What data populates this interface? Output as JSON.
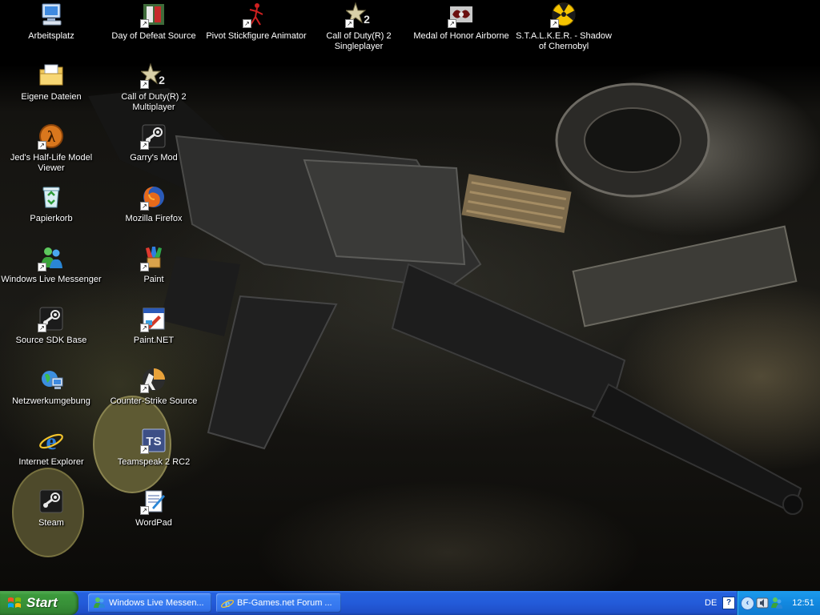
{
  "desktop": {
    "icons": [
      {
        "label": "Arbeitsplatz",
        "icon": "my-computer-icon",
        "shortcut": false
      },
      {
        "label": "Day of Defeat Source",
        "icon": "dod-source-icon",
        "shortcut": true
      },
      {
        "label": "Pivot Stickfigure Animator",
        "icon": "pivot-icon",
        "shortcut": true
      },
      {
        "label": "Call of Duty(R) 2 Singleplayer",
        "icon": "cod2-icon",
        "shortcut": true
      },
      {
        "label": "Medal of Honor Airborne",
        "icon": "moh-icon",
        "shortcut": true
      },
      {
        "label": "S.T.A.L.K.E.R. - Shadow of Chernobyl",
        "icon": "radiation-icon",
        "shortcut": true
      },
      {
        "label": "Eigene Dateien",
        "icon": "my-documents-icon",
        "shortcut": false
      },
      {
        "label": "Call of Duty(R) 2 Multiplayer",
        "icon": "cod2-icon",
        "shortcut": true
      },
      {
        "label": "Jed's Half-Life Model Viewer",
        "icon": "half-life-icon",
        "shortcut": true
      },
      {
        "label": "Garry's Mod",
        "icon": "steam-icon",
        "shortcut": true
      },
      {
        "label": "Papierkorb",
        "icon": "recycle-bin-icon",
        "shortcut": false
      },
      {
        "label": "Mozilla Firefox",
        "icon": "firefox-icon",
        "shortcut": true
      },
      {
        "label": "Windows Live Messenger",
        "icon": "messenger-icon",
        "shortcut": true
      },
      {
        "label": "Paint",
        "icon": "paint-icon",
        "shortcut": true
      },
      {
        "label": "Source SDK Base",
        "icon": "steam-icon",
        "shortcut": true
      },
      {
        "label": "Paint.NET",
        "icon": "paintnet-icon",
        "shortcut": true
      },
      {
        "label": "Netzwerkumgebung",
        "icon": "network-icon",
        "shortcut": false
      },
      {
        "label": "Counter-Strike Source",
        "icon": "counter-strike-icon",
        "shortcut": true
      },
      {
        "label": "Internet Explorer",
        "icon": "internet-explorer-icon",
        "shortcut": false
      },
      {
        "label": "Teamspeak 2 RC2",
        "icon": "teamspeak-icon",
        "shortcut": true
      },
      {
        "label": "Steam",
        "icon": "steam-icon",
        "shortcut": false
      },
      {
        "label": "WordPad",
        "icon": "wordpad-icon",
        "shortcut": true
      }
    ]
  },
  "taskbar": {
    "start_label": "Start",
    "windows": [
      {
        "label": "Windows Live Messen...",
        "icon": "messenger-icon"
      },
      {
        "label": "BF-Games.net Forum ...",
        "icon": "internet-explorer-icon"
      }
    ],
    "language": "DE",
    "help_label": "?",
    "tray_expand": "‹",
    "tray_icons": [
      "volume-icon",
      "messenger-tray-icon"
    ],
    "clock": "12:51"
  },
  "colors": {
    "taskbar_blue": "#235bd9",
    "start_green": "#378f37",
    "tray_blue": "#1288e0"
  }
}
